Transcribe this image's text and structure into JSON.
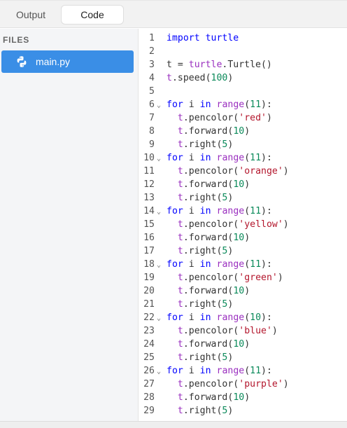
{
  "tabs": {
    "output_label": "Output",
    "code_label": "Code",
    "active": "Code"
  },
  "sidebar": {
    "files_label": "FILES",
    "file_name": "main.py",
    "file_icon": "python-icon"
  },
  "colors": {
    "accent": "#3a8ee6",
    "keyword": "#0000ff",
    "builtin": "#9a2fbf",
    "number": "#0b8a5a",
    "string": "#b3162c"
  },
  "editor": {
    "lines": [
      {
        "n": "1",
        "fold": false,
        "tokens": [
          {
            "t": "import turtle",
            "c": "kw2"
          }
        ]
      },
      {
        "n": "2",
        "fold": false,
        "tokens": []
      },
      {
        "n": "3",
        "fold": false,
        "tokens": [
          {
            "t": "t = ",
            "c": ""
          },
          {
            "t": "turtle",
            "c": "bi"
          },
          {
            "t": ".Turtle()",
            "c": ""
          }
        ]
      },
      {
        "n": "4",
        "fold": false,
        "tokens": [
          {
            "t": "t",
            "c": "bi"
          },
          {
            "t": ".speed(",
            "c": ""
          },
          {
            "t": "100",
            "c": "num"
          },
          {
            "t": ")",
            "c": ""
          }
        ]
      },
      {
        "n": "5",
        "fold": false,
        "tokens": []
      },
      {
        "n": "6",
        "fold": true,
        "tokens": [
          {
            "t": "for",
            "c": "kw"
          },
          {
            "t": " i ",
            "c": ""
          },
          {
            "t": "in",
            "c": "kw"
          },
          {
            "t": " ",
            "c": ""
          },
          {
            "t": "range",
            "c": "bi"
          },
          {
            "t": "(",
            "c": ""
          },
          {
            "t": "11",
            "c": "num"
          },
          {
            "t": "):",
            "c": ""
          }
        ]
      },
      {
        "n": "7",
        "fold": false,
        "tokens": [
          {
            "t": "  ",
            "c": ""
          },
          {
            "t": "t",
            "c": "bi"
          },
          {
            "t": ".pencolor(",
            "c": ""
          },
          {
            "t": "'red'",
            "c": "str"
          },
          {
            "t": ")",
            "c": ""
          }
        ]
      },
      {
        "n": "8",
        "fold": false,
        "tokens": [
          {
            "t": "  ",
            "c": ""
          },
          {
            "t": "t",
            "c": "bi"
          },
          {
            "t": ".forward(",
            "c": ""
          },
          {
            "t": "10",
            "c": "num"
          },
          {
            "t": ")",
            "c": ""
          }
        ]
      },
      {
        "n": "9",
        "fold": false,
        "tokens": [
          {
            "t": "  ",
            "c": ""
          },
          {
            "t": "t",
            "c": "bi"
          },
          {
            "t": ".right(",
            "c": ""
          },
          {
            "t": "5",
            "c": "num"
          },
          {
            "t": ")",
            "c": ""
          }
        ]
      },
      {
        "n": "10",
        "fold": true,
        "tokens": [
          {
            "t": "for",
            "c": "kw"
          },
          {
            "t": " i ",
            "c": ""
          },
          {
            "t": "in",
            "c": "kw"
          },
          {
            "t": " ",
            "c": ""
          },
          {
            "t": "range",
            "c": "bi"
          },
          {
            "t": "(",
            "c": ""
          },
          {
            "t": "11",
            "c": "num"
          },
          {
            "t": "):",
            "c": ""
          }
        ]
      },
      {
        "n": "11",
        "fold": false,
        "tokens": [
          {
            "t": "  ",
            "c": ""
          },
          {
            "t": "t",
            "c": "bi"
          },
          {
            "t": ".pencolor(",
            "c": ""
          },
          {
            "t": "'orange'",
            "c": "str"
          },
          {
            "t": ")",
            "c": ""
          }
        ]
      },
      {
        "n": "12",
        "fold": false,
        "tokens": [
          {
            "t": "  ",
            "c": ""
          },
          {
            "t": "t",
            "c": "bi"
          },
          {
            "t": ".forward(",
            "c": ""
          },
          {
            "t": "10",
            "c": "num"
          },
          {
            "t": ")",
            "c": ""
          }
        ]
      },
      {
        "n": "13",
        "fold": false,
        "tokens": [
          {
            "t": "  ",
            "c": ""
          },
          {
            "t": "t",
            "c": "bi"
          },
          {
            "t": ".right(",
            "c": ""
          },
          {
            "t": "5",
            "c": "num"
          },
          {
            "t": ")",
            "c": ""
          }
        ]
      },
      {
        "n": "14",
        "fold": true,
        "tokens": [
          {
            "t": "for",
            "c": "kw"
          },
          {
            "t": " i ",
            "c": ""
          },
          {
            "t": "in",
            "c": "kw"
          },
          {
            "t": " ",
            "c": ""
          },
          {
            "t": "range",
            "c": "bi"
          },
          {
            "t": "(",
            "c": ""
          },
          {
            "t": "11",
            "c": "num"
          },
          {
            "t": "):",
            "c": ""
          }
        ]
      },
      {
        "n": "15",
        "fold": false,
        "tokens": [
          {
            "t": "  ",
            "c": ""
          },
          {
            "t": "t",
            "c": "bi"
          },
          {
            "t": ".pencolor(",
            "c": ""
          },
          {
            "t": "'yellow'",
            "c": "str"
          },
          {
            "t": ")",
            "c": ""
          }
        ]
      },
      {
        "n": "16",
        "fold": false,
        "tokens": [
          {
            "t": "  ",
            "c": ""
          },
          {
            "t": "t",
            "c": "bi"
          },
          {
            "t": ".forward(",
            "c": ""
          },
          {
            "t": "10",
            "c": "num"
          },
          {
            "t": ")",
            "c": ""
          }
        ]
      },
      {
        "n": "17",
        "fold": false,
        "tokens": [
          {
            "t": "  ",
            "c": ""
          },
          {
            "t": "t",
            "c": "bi"
          },
          {
            "t": ".right(",
            "c": ""
          },
          {
            "t": "5",
            "c": "num"
          },
          {
            "t": ")",
            "c": ""
          }
        ]
      },
      {
        "n": "18",
        "fold": true,
        "tokens": [
          {
            "t": "for",
            "c": "kw"
          },
          {
            "t": " i ",
            "c": ""
          },
          {
            "t": "in",
            "c": "kw"
          },
          {
            "t": " ",
            "c": ""
          },
          {
            "t": "range",
            "c": "bi"
          },
          {
            "t": "(",
            "c": ""
          },
          {
            "t": "11",
            "c": "num"
          },
          {
            "t": "):",
            "c": ""
          }
        ]
      },
      {
        "n": "19",
        "fold": false,
        "tokens": [
          {
            "t": "  ",
            "c": ""
          },
          {
            "t": "t",
            "c": "bi"
          },
          {
            "t": ".pencolor(",
            "c": ""
          },
          {
            "t": "'green'",
            "c": "str"
          },
          {
            "t": ")",
            "c": ""
          }
        ]
      },
      {
        "n": "20",
        "fold": false,
        "tokens": [
          {
            "t": "  ",
            "c": ""
          },
          {
            "t": "t",
            "c": "bi"
          },
          {
            "t": ".forward(",
            "c": ""
          },
          {
            "t": "10",
            "c": "num"
          },
          {
            "t": ")",
            "c": ""
          }
        ]
      },
      {
        "n": "21",
        "fold": false,
        "tokens": [
          {
            "t": "  ",
            "c": ""
          },
          {
            "t": "t",
            "c": "bi"
          },
          {
            "t": ".right(",
            "c": ""
          },
          {
            "t": "5",
            "c": "num"
          },
          {
            "t": ")",
            "c": ""
          }
        ]
      },
      {
        "n": "22",
        "fold": true,
        "tokens": [
          {
            "t": "for",
            "c": "kw"
          },
          {
            "t": " i ",
            "c": ""
          },
          {
            "t": "in",
            "c": "kw"
          },
          {
            "t": " ",
            "c": ""
          },
          {
            "t": "range",
            "c": "bi"
          },
          {
            "t": "(",
            "c": ""
          },
          {
            "t": "10",
            "c": "num"
          },
          {
            "t": "):",
            "c": ""
          }
        ]
      },
      {
        "n": "23",
        "fold": false,
        "tokens": [
          {
            "t": "  ",
            "c": ""
          },
          {
            "t": "t",
            "c": "bi"
          },
          {
            "t": ".pencolor(",
            "c": ""
          },
          {
            "t": "'blue'",
            "c": "str"
          },
          {
            "t": ")",
            "c": ""
          }
        ]
      },
      {
        "n": "24",
        "fold": false,
        "tokens": [
          {
            "t": "  ",
            "c": ""
          },
          {
            "t": "t",
            "c": "bi"
          },
          {
            "t": ".forward(",
            "c": ""
          },
          {
            "t": "10",
            "c": "num"
          },
          {
            "t": ")",
            "c": ""
          }
        ]
      },
      {
        "n": "25",
        "fold": false,
        "tokens": [
          {
            "t": "  ",
            "c": ""
          },
          {
            "t": "t",
            "c": "bi"
          },
          {
            "t": ".right(",
            "c": ""
          },
          {
            "t": "5",
            "c": "num"
          },
          {
            "t": ")",
            "c": ""
          }
        ]
      },
      {
        "n": "26",
        "fold": true,
        "tokens": [
          {
            "t": "for",
            "c": "kw"
          },
          {
            "t": " i ",
            "c": ""
          },
          {
            "t": "in",
            "c": "kw"
          },
          {
            "t": " ",
            "c": ""
          },
          {
            "t": "range",
            "c": "bi"
          },
          {
            "t": "(",
            "c": ""
          },
          {
            "t": "11",
            "c": "num"
          },
          {
            "t": "):",
            "c": ""
          }
        ]
      },
      {
        "n": "27",
        "fold": false,
        "tokens": [
          {
            "t": "  ",
            "c": ""
          },
          {
            "t": "t",
            "c": "bi"
          },
          {
            "t": ".pencolor(",
            "c": ""
          },
          {
            "t": "'purple'",
            "c": "str"
          },
          {
            "t": ")",
            "c": ""
          }
        ]
      },
      {
        "n": "28",
        "fold": false,
        "tokens": [
          {
            "t": "  ",
            "c": ""
          },
          {
            "t": "t",
            "c": "bi"
          },
          {
            "t": ".forward(",
            "c": ""
          },
          {
            "t": "10",
            "c": "num"
          },
          {
            "t": ")",
            "c": ""
          }
        ]
      },
      {
        "n": "29",
        "fold": false,
        "tokens": [
          {
            "t": "  ",
            "c": ""
          },
          {
            "t": "t",
            "c": "bi"
          },
          {
            "t": ".right(",
            "c": ""
          },
          {
            "t": "5",
            "c": "num"
          },
          {
            "t": ")",
            "c": ""
          }
        ]
      }
    ]
  }
}
